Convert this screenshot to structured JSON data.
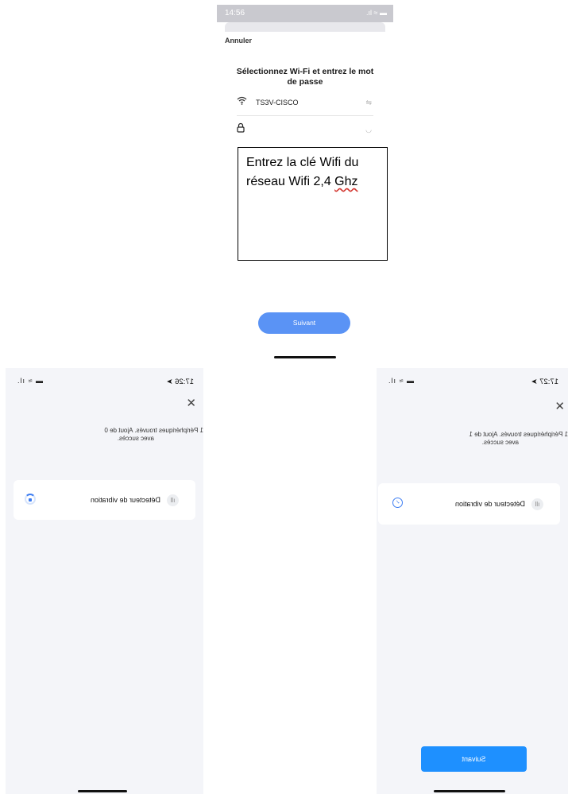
{
  "top": {
    "status_time": "14:56",
    "status_icons": ".ıl ≈ ▬",
    "cancel_label": "Annuler",
    "title": "Sélectionnez Wi-Fi et entrez le mot de passe",
    "ssid": "TS3V-CISCO",
    "annotation_line1": "Entrez la clé Wifi du",
    "annotation_line2_a": "réseau Wifi 2,4 ",
    "annotation_line2_b": "Ghz",
    "next_label": "Suivant"
  },
  "left": {
    "status_time": "17:26",
    "status_icons": "▬ ≈ ıl.",
    "found_text_line1": "1 Périphériques trouvés. Ajout de 0",
    "found_text_line2": "avec succès.",
    "device_name": "Détecteur de vibration"
  },
  "right": {
    "status_time": "17:27",
    "status_icons": "▬ ≈ ıl.",
    "found_text_line1": "1 Périphériques trouvés. Ajout de 1",
    "found_text_line2": "avec succès.",
    "device_name": "Détecteur de vibration",
    "next_label": "Suivant"
  },
  "colors": {
    "accent": "#3d7df2",
    "button_top": "#5a93f5",
    "button_right": "#1e90ff"
  },
  "icons": [
    "wifi-icon",
    "lock-icon",
    "eye-icon",
    "close-icon",
    "vibration-sensor-icon",
    "spinner-icon",
    "check-circle-icon"
  ]
}
